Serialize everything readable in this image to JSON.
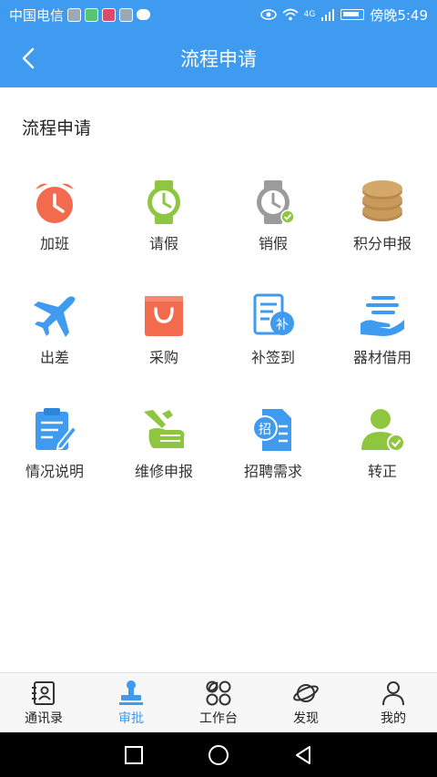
{
  "status": {
    "carrier": "中国电信",
    "time": "傍晚5:49",
    "network": "4G"
  },
  "header": {
    "title": "流程申请"
  },
  "section": {
    "title": "流程申请"
  },
  "items": [
    {
      "label": "加班",
      "icon": "alarm-clock-icon",
      "color": "#f26b4f"
    },
    {
      "label": "请假",
      "icon": "watch-icon",
      "color": "#8ec63f"
    },
    {
      "label": "销假",
      "icon": "watch-check-icon",
      "color": "#9b9b9b"
    },
    {
      "label": "积分申报",
      "icon": "coins-icon",
      "color": "#c89a5b"
    },
    {
      "label": "出差",
      "icon": "airplane-icon",
      "color": "#3e9bf0"
    },
    {
      "label": "采购",
      "icon": "shopping-bag-icon",
      "color": "#f26b4f"
    },
    {
      "label": "补签到",
      "icon": "doc-supplement-icon",
      "color": "#3e9bf0"
    },
    {
      "label": "器材借用",
      "icon": "hand-items-icon",
      "color": "#3e9bf0"
    },
    {
      "label": "情况说明",
      "icon": "clipboard-edit-icon",
      "color": "#3e9bf0"
    },
    {
      "label": "维修申报",
      "icon": "wrench-hand-icon",
      "color": "#8ec63f"
    },
    {
      "label": "招聘需求",
      "icon": "recruit-doc-icon",
      "color": "#3e9bf0"
    },
    {
      "label": "转正",
      "icon": "person-check-icon",
      "color": "#8ec63f"
    }
  ],
  "tabs": [
    {
      "label": "通讯录",
      "icon": "contacts-icon"
    },
    {
      "label": "审批",
      "icon": "stamp-icon",
      "active": true
    },
    {
      "label": "工作台",
      "icon": "workbench-icon"
    },
    {
      "label": "发现",
      "icon": "planet-icon"
    },
    {
      "label": "我的",
      "icon": "user-icon"
    }
  ],
  "colors": {
    "accent": "#3e9bf0",
    "orange": "#f26b4f",
    "green": "#8ec63f",
    "gray": "#9b9b9b",
    "gold": "#c89a5b"
  }
}
